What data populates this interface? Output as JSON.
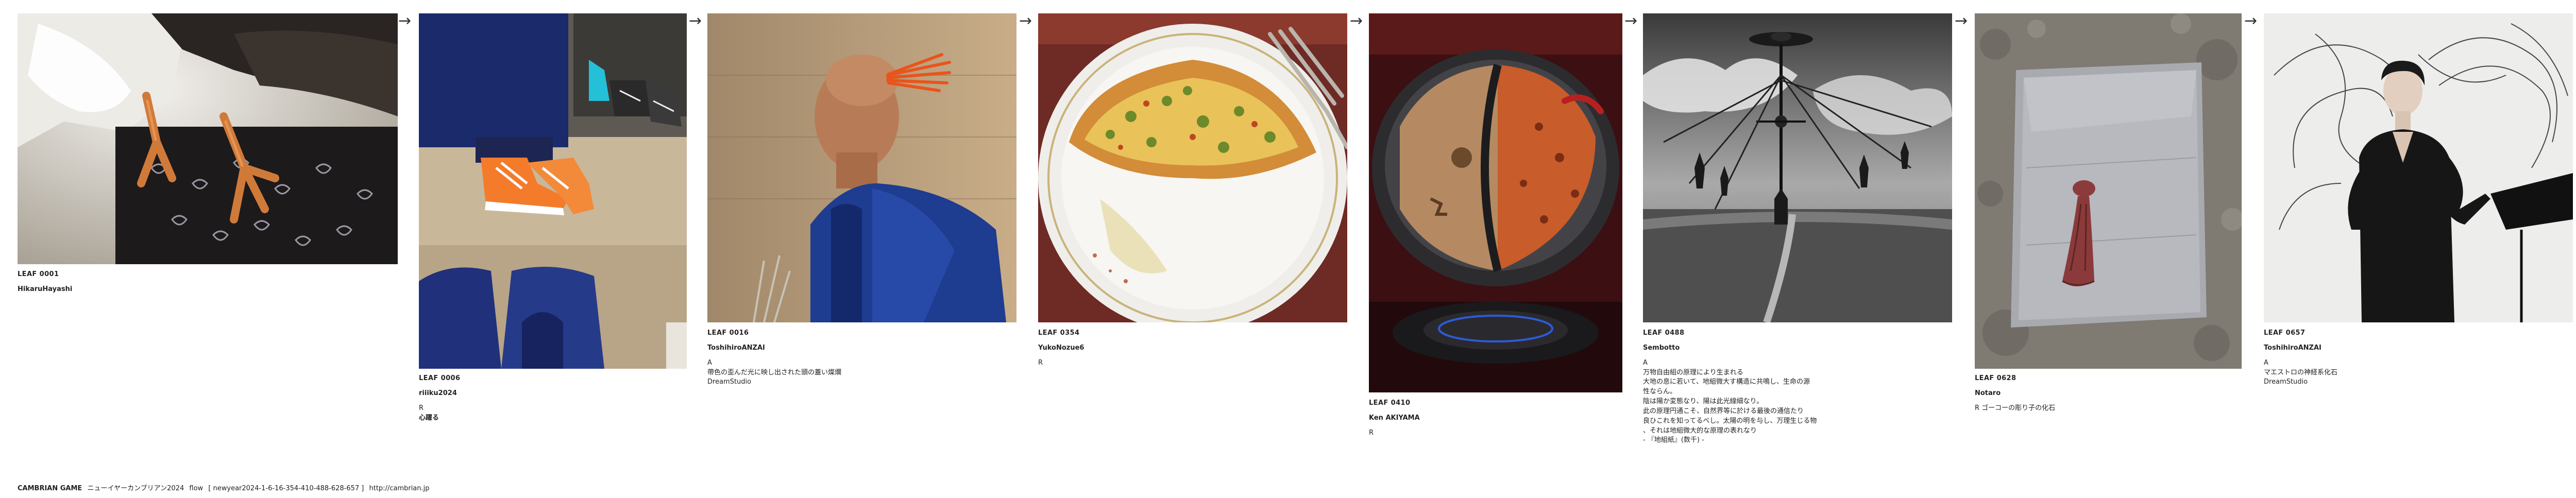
{
  "leaves": [
    {
      "id": "LEAF 0001",
      "author": "HikaruHayashi",
      "lines": []
    },
    {
      "id": "LEAF 0006",
      "author": "riiiku2024",
      "lines": [
        "R",
        "心躍る"
      ]
    },
    {
      "id": "LEAF 0016",
      "author": "ToshihiroANZAI",
      "lines": [
        "A",
        "帶色の歪んだ光に映し出された頭の蓋い燦爛",
        "DreamStudio"
      ]
    },
    {
      "id": "LEAF 0354",
      "author": "YukoNozue6",
      "lines": [
        "R"
      ]
    },
    {
      "id": "LEAF 0410",
      "author": "Ken AKIYAMA",
      "lines": [
        "R"
      ]
    },
    {
      "id": "LEAF 0488",
      "author": "Sembotto",
      "lines": [
        "A",
        "万物自由組の原理により生まれる",
        "大地の息に若いて、地組微大す構造に共鳴し、生命の源",
        "性ならん。",
        "陰は陽か変態なり、陽は此光線細なり。",
        "此の原理円通こそ、自然界等に於ける最後の通信たり",
        "良ひこれを知ってるべし。太陽の明を与し、万理生じる物",
        "、それは地組微大的な原理の表れなり",
        "- 『地組紙』(数千) -"
      ]
    },
    {
      "id": "LEAF 0628",
      "author": "Notaro",
      "lines": [
        "R ゴーコーの彫り子の化石"
      ]
    },
    {
      "id": "LEAF 0657",
      "author": "ToshihiroANZAI",
      "lines": [
        "A",
        "マエストロの神経系化石",
        "DreamStudio"
      ]
    }
  ],
  "arrow_glyph": "→",
  "footer": {
    "brand": "CAMBRIAN GAME",
    "game": "ニューイヤーカンブリアン2024",
    "flow_label": "flow",
    "flow_id": "[ newyear2024-1-6-16-354-410-488-628-657 ]",
    "url": "http://cambrian.jp"
  }
}
